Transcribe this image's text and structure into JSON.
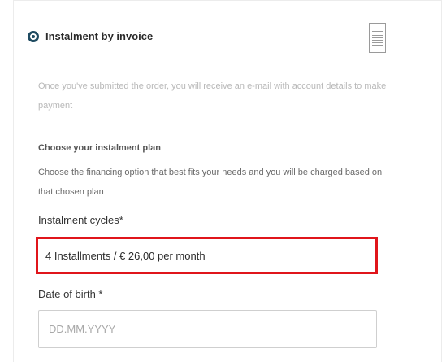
{
  "payment_method": {
    "title": "Instalment by invoice",
    "selected": true,
    "icon": "invoice-document-icon",
    "info": "Once you've submitted the order, you will receive an e-mail with account details to make payment"
  },
  "instalment_plan": {
    "heading": "Choose your instalment plan",
    "description": "Choose the financing option that best fits your needs and you will be charged based on that chosen plan"
  },
  "cycles_field": {
    "label": "Instalment cycles*",
    "value": "4 Installments / € 26,00 per month"
  },
  "dob_field": {
    "label": "Date of birth *",
    "value": "",
    "placeholder": "DD.MM.YYYY"
  },
  "colors": {
    "radio": "#1f4b61",
    "highlight_border": "#e0151b"
  }
}
